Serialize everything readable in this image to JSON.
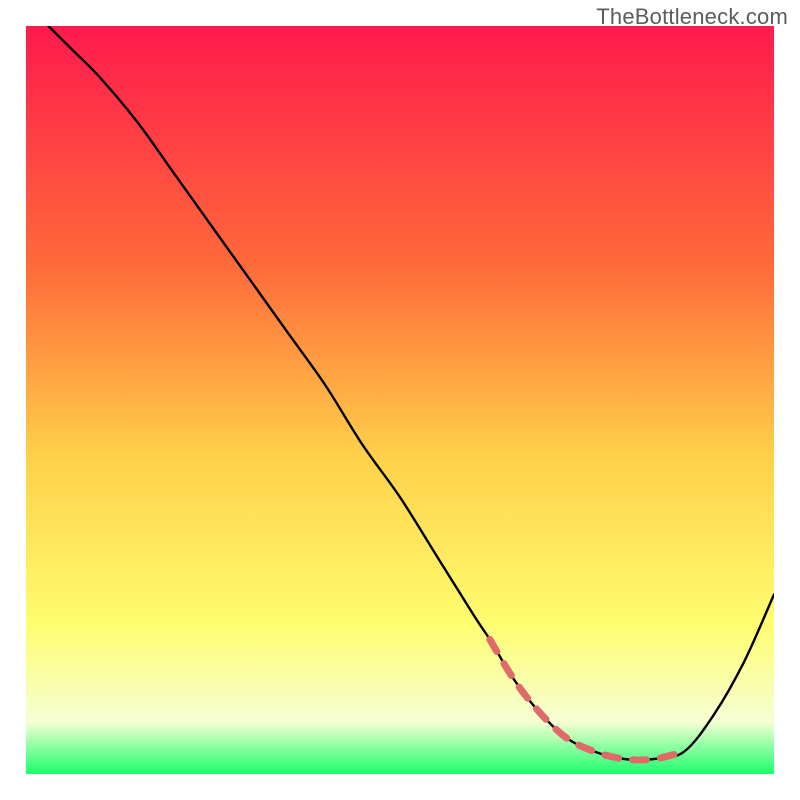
{
  "watermark": {
    "text": "TheBottleneck.com"
  },
  "colors": {
    "grad_top": "#ff1a4d",
    "grad_mid1": "#ff6a3a",
    "grad_mid2": "#ffd24a",
    "grad_yellow": "#fffd70",
    "grad_pale": "#f6ffd4",
    "grad_green": "#1bff6b",
    "curve_stroke": "#000000",
    "dash_stroke": "#e06a6a",
    "border": "#ffffff"
  },
  "chart_data": {
    "type": "line",
    "title": "",
    "xlabel": "",
    "ylabel": "",
    "xlim": [
      0,
      100
    ],
    "ylim": [
      0,
      100
    ],
    "series": [
      {
        "name": "bottleneck-curve",
        "x": [
          3,
          6,
          10,
          15,
          20,
          25,
          30,
          35,
          40,
          45,
          50,
          55,
          60,
          62,
          65,
          68,
          72,
          76,
          80,
          84,
          88,
          92,
          96,
          100
        ],
        "y": [
          100,
          97,
          93,
          87,
          80,
          73,
          66,
          59,
          52,
          44,
          37,
          29,
          21,
          18,
          13,
          9,
          5,
          3,
          2,
          2,
          3,
          8,
          15,
          24
        ]
      }
    ],
    "optimal_band": {
      "name": "optimal-range-dashes",
      "x": [
        62,
        65,
        68,
        72,
        76,
        80,
        84,
        88
      ],
      "y": [
        18,
        13,
        9,
        5,
        3,
        2,
        2,
        3
      ]
    }
  }
}
